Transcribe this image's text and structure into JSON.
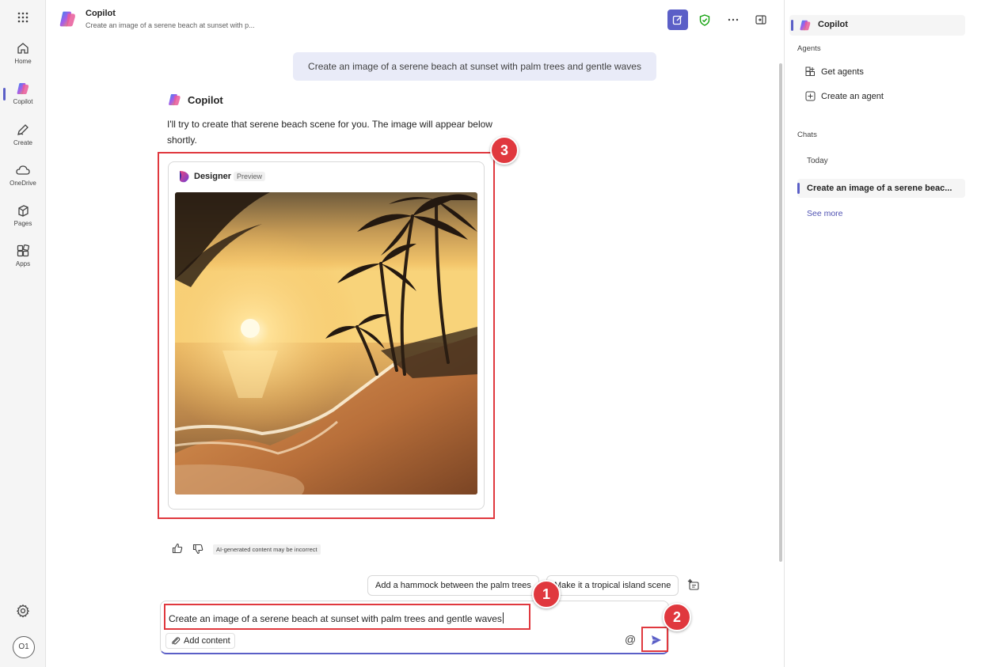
{
  "app": {
    "title": "Copilot",
    "subtitle": "Create an image of a serene beach at sunset with p..."
  },
  "rail": {
    "items": [
      {
        "label": "Home",
        "icon": "home-icon"
      },
      {
        "label": "Copilot",
        "icon": "copilot-icon",
        "active": true
      },
      {
        "label": "Create",
        "icon": "pencil-icon"
      },
      {
        "label": "OneDrive",
        "icon": "cloud-icon"
      },
      {
        "label": "Pages",
        "icon": "pages-icon"
      },
      {
        "label": "Apps",
        "icon": "apps-icon"
      }
    ],
    "avatar_initials": "O1"
  },
  "conversation": {
    "user_message": "Create an image of a serene beach at sunset with palm trees and gentle waves",
    "bot_name": "Copilot",
    "bot_reply": "I'll try to create that serene beach scene for you. The image will appear below shortly.",
    "designer": {
      "name": "Designer",
      "tag": "Preview"
    },
    "disclaimer": "AI-generated content may be incorrect"
  },
  "suggestions": [
    "Add a hammock between the palm trees",
    "Make it a tropical island scene"
  ],
  "composer": {
    "value": "Create an image of a serene beach at sunset with palm trees and gentle waves",
    "add_content_label": "Add content",
    "at_label": "@"
  },
  "annotations": [
    "1",
    "2",
    "3"
  ],
  "right_panel": {
    "title": "Copilot",
    "agents_heading": "Agents",
    "agent_items": [
      "Get agents",
      "Create an agent"
    ],
    "chats_heading": "Chats",
    "today_label": "Today",
    "active_chat": "Create an image of a serene beac...",
    "see_more": "See more"
  },
  "colors": {
    "accent": "#5b5fc7",
    "highlight_red": "#e0383e",
    "user_bubble": "#e9ebf8"
  }
}
